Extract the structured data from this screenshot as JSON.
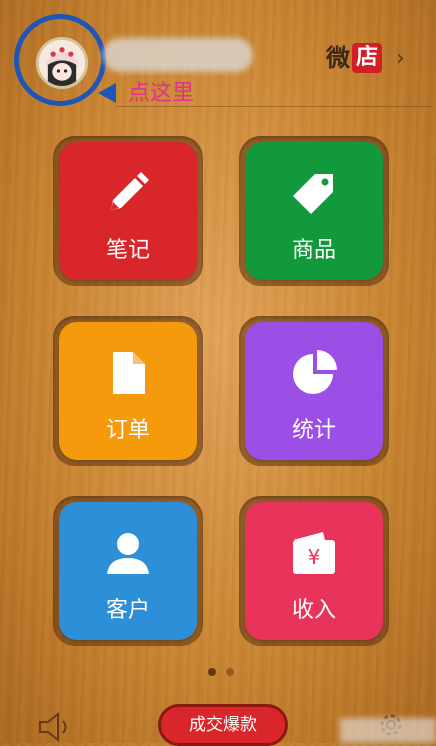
{
  "header": {
    "hint_text": "点这里",
    "shop_label_1": "微",
    "shop_label_2": "店",
    "chevron": "›"
  },
  "tiles": [
    {
      "label": "笔记",
      "icon": "pencil-icon",
      "color": "#d8262a"
    },
    {
      "label": "商品",
      "icon": "tag-icon",
      "color": "#12993b"
    },
    {
      "label": "订单",
      "icon": "document-icon",
      "color": "#f59a0c"
    },
    {
      "label": "统计",
      "icon": "pie-chart-icon",
      "color": "#9b4fe6"
    },
    {
      "label": "客户",
      "icon": "person-icon",
      "color": "#2d8fd8"
    },
    {
      "label": "收入",
      "icon": "wallet-yen-icon",
      "color": "#e8335a"
    }
  ],
  "wallet_symbol": "¥",
  "pager": {
    "pages": 2,
    "active": 1
  },
  "bottom_bar": {
    "deal_button": "成交爆款",
    "left_icon": "speaker-icon",
    "right_icon": "gear-icon"
  },
  "colors": {
    "annotation_blue": "#1f55b8",
    "annotation_pink": "#e0338a",
    "shop_red": "#d21f26"
  }
}
